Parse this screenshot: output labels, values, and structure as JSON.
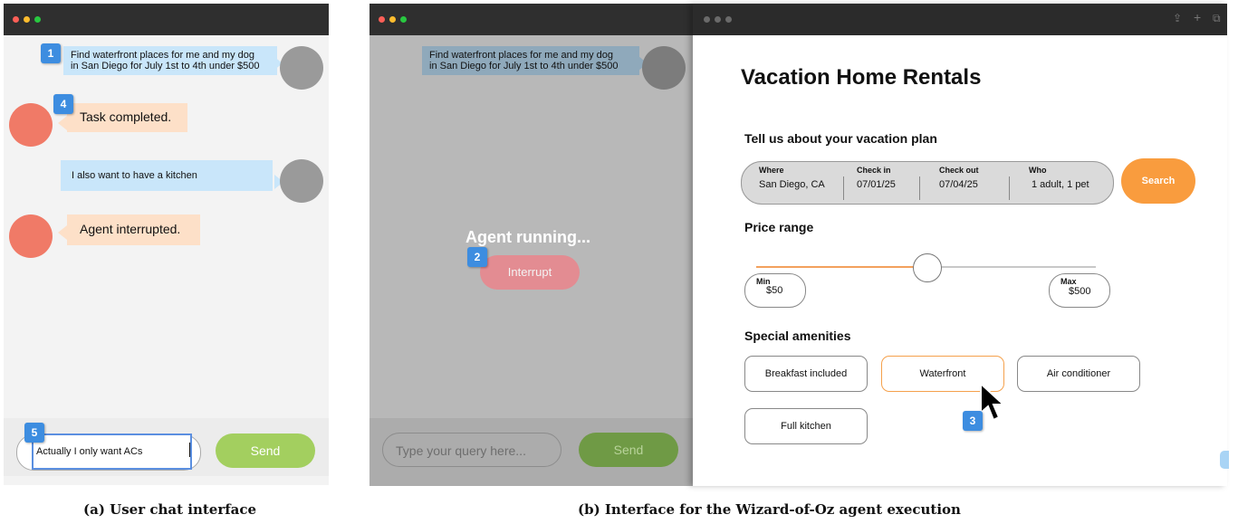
{
  "user_chat": {
    "messages": [
      {
        "role": "user",
        "text_line1": "Find waterfront places for me and my dog",
        "text_line2": "in San Diego for July 1st to 4th under $500",
        "badge": "1"
      },
      {
        "role": "agent",
        "text": "Task completed.",
        "badge": "4"
      },
      {
        "role": "user",
        "text": "I also want to have a kitchen"
      },
      {
        "role": "agent",
        "text": "Agent interrupted."
      }
    ],
    "input_value": "Actually I only want ACs",
    "input_badge": "5",
    "send_label": "Send"
  },
  "wizard_chat": {
    "message_line1": "Find waterfront places for me and my dog",
    "message_line2": "in San Diego for July 1st to 4th under $500",
    "overlay_title": "Agent running...",
    "interrupt_label": "Interrupt",
    "interrupt_badge": "2",
    "input_placeholder": "Type your query here...",
    "send_label": "Send"
  },
  "rental": {
    "title": "Vacation Home Rentals",
    "plan_heading": "Tell us about your vacation plan",
    "fields": [
      {
        "label": "Where",
        "value": "San Diego, CA"
      },
      {
        "label": "Check in",
        "value": "07/01/25"
      },
      {
        "label": "Check out",
        "value": "07/04/25"
      },
      {
        "label": "Who",
        "value": "1 adult, 1 pet"
      }
    ],
    "search_label": "Search",
    "price_heading": "Price range",
    "min_label": "Min",
    "min_value": "$50",
    "max_label": "Max",
    "max_value": "$500",
    "slider_level_fraction": 0.5,
    "amenities_heading": "Special amenities",
    "amenities": [
      "Breakfast included",
      "Waterfront",
      "Air conditioner",
      "Full kitchen"
    ],
    "selected_amenity": "Waterfront",
    "cursor_badge": "3"
  },
  "captions": {
    "a": "(a) User chat interface",
    "b": "(b) Interface for the Wizard-of-Oz agent execution"
  },
  "colors": {
    "user_bubble": "#c9e6fa",
    "agent_bubble": "#fde0c8",
    "badge": "#3d8de0",
    "send_green": "#a3cf5f",
    "search_orange": "#f99c3e",
    "interrupt": "#e38c92",
    "agent_avatar": "#f07a67"
  }
}
